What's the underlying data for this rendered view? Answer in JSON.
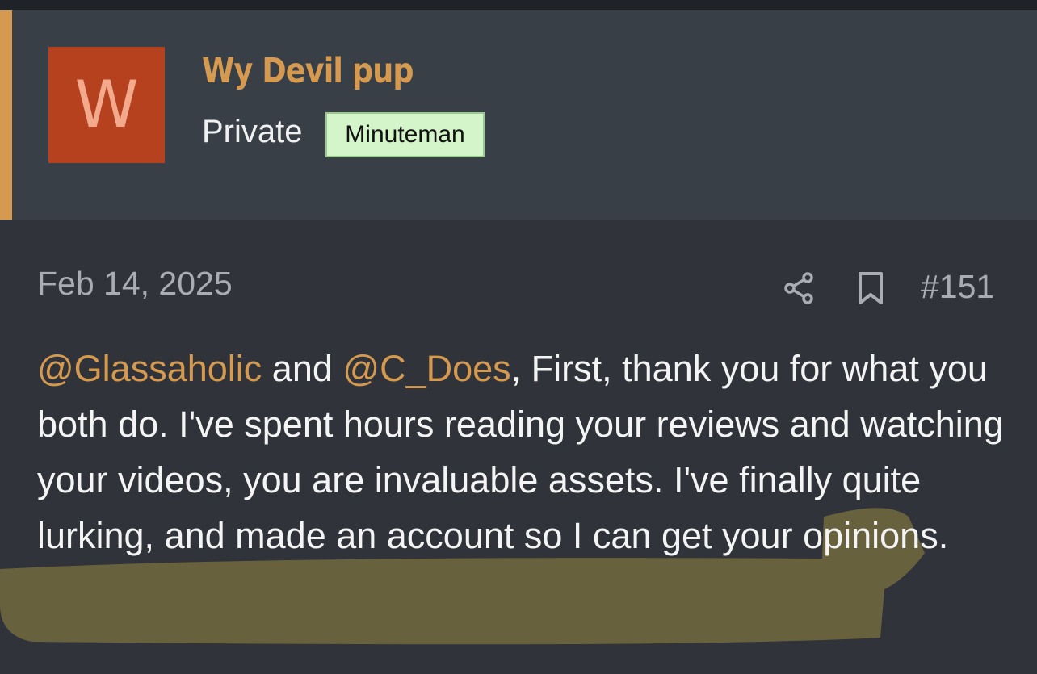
{
  "author": {
    "avatar_letter": "W",
    "name": "Wy Devil pup",
    "rank": "Private",
    "badge": "Minuteman",
    "avatar_color": "#b5411f",
    "name_color": "#d59a4f"
  },
  "post": {
    "date": "Feb 14, 2025",
    "number": "#151",
    "mention1": "@Glassaholic",
    "and_text": " and ",
    "mention2": "@C_Does",
    "text": ", First, thank you for what you both do. I've spent hours reading your reviews and watching your videos, you are invaluable assets. I've finally quite lurking, and made an account so I can get your opinions.",
    "icons": [
      "share-icon",
      "bookmark-icon"
    ]
  },
  "colors": {
    "accent": "#d59a4f",
    "highlight": "#b8a045",
    "badge_bg": "#d3f5c9"
  }
}
